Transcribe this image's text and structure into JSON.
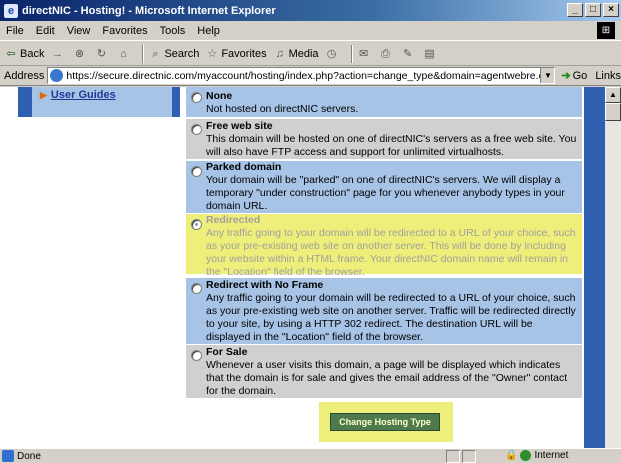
{
  "window": {
    "title": "directNIC - Hosting! - Microsoft Internet Explorer",
    "buttons": [
      "_",
      "□",
      "×"
    ]
  },
  "menubar": {
    "items": [
      "File",
      "Edit",
      "View",
      "Favorites",
      "Tools",
      "Help"
    ]
  },
  "toolbar": {
    "back": "Back",
    "search": "Search",
    "favorites": "Favorites",
    "media": "Media"
  },
  "address": {
    "label": "Address",
    "url": "https://secure.directnic.com/myaccount/hosting/index.php?action=change_type&domain=agentwebre.com",
    "go": "Go",
    "links": "Links"
  },
  "sidebar": {
    "link": "User Guides"
  },
  "options": [
    {
      "title": "None",
      "desc": "Not hosted on directNIC servers.",
      "selected": false
    },
    {
      "title": "Free web site",
      "desc": "This domain will be hosted on one of directNIC's servers as a free web site. You will also have FTP access and support for unlimited virtualhosts.",
      "selected": false
    },
    {
      "title": "Parked domain",
      "desc": "Your domain will be \"parked\" on one of directNIC's servers. We will display a temporary \"under construction\" page for you whenever anybody types in your domain URL.",
      "selected": false
    },
    {
      "title": "Redirected",
      "desc": "Any traffic going to your domain will be redirected to a URL of your choice, such as your pre-existing web site on another server. This will be done by including your website within a HTML frame. Your directNIC domain name will remain in the \"Location\" field of the browser.",
      "selected": true
    },
    {
      "title": "Redirect with No Frame",
      "desc": "Any traffic going to your domain will be redirected to a URL of your choice, such as your pre-existing web site on another server. Traffic will be redirected directly to your site, by using a HTTP 302 redirect. The destination URL will be displayed in the \"Location\" field of the browser.",
      "selected": false
    },
    {
      "title": "For Sale",
      "desc": "Whenever a user visits this domain, a page will be displayed which indicates that the domain is for sale and gives the email address of the \"Owner\" contact for the domain.",
      "selected": false
    }
  ],
  "submit": {
    "label": "Change Hosting Type"
  },
  "status": {
    "text": "Done",
    "zone": "Internet"
  },
  "colors": {
    "page_blue": "#2f5fb0",
    "option_blue": "#a7c3e6",
    "option_gray": "#d0d0d0",
    "highlight_yellow": "#eeee7a",
    "button_green": "#4e7a4e"
  }
}
